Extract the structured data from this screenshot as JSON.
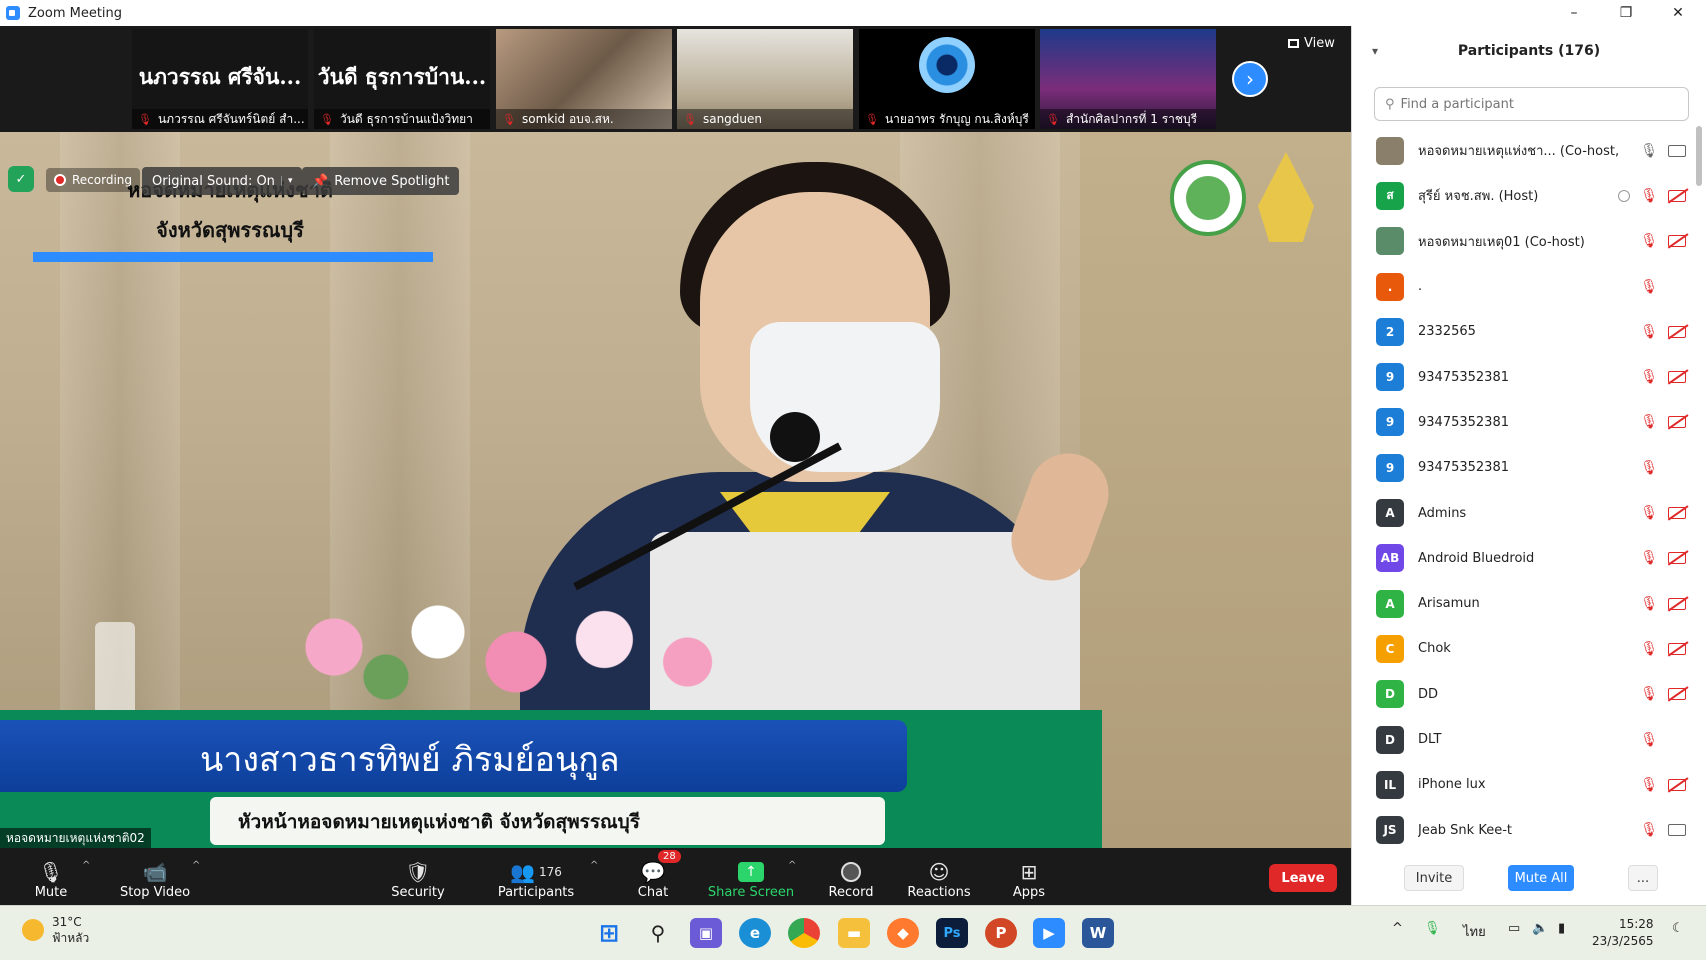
{
  "window": {
    "title": "Zoom Meeting",
    "controls": [
      "–",
      "❐",
      "✕"
    ]
  },
  "thumbnails": [
    {
      "big": "นภวรรณ ศรีจัน...",
      "name": "นภวรรณ ศรีจันทร์นิตย์ สำ..."
    },
    {
      "big": "วันดี ธุรการบ้าน...",
      "name": "วันดี ธุรการบ้านแป้งวิทยา"
    },
    {
      "big": "",
      "name": "somkid อบจ.สห."
    },
    {
      "big": "",
      "name": "sangduen"
    },
    {
      "big": "",
      "name": "นายอาทร รักบุญ กน.สิงห์บุรี"
    },
    {
      "big": "",
      "name": "สำนักศิลปากรที่ 1 ราชบุรี"
    }
  ],
  "view_label": "View",
  "overlay": {
    "recording": "Recording",
    "original_sound": "Original Sound: On",
    "remove_spotlight": "Remove Spotlight"
  },
  "speaker": {
    "org_line1": "หอจดหมายเหตุแห่งชาติ",
    "org_line2": "จังหวัดสุพรรณบุรี",
    "lower_name": "นางสาวธารทิพย์ ภิรมย์อนุกูล",
    "lower_role": "หัวหน้าหอจดหมายเหตุแห่งชาติ จังหวัดสุพรรณบุรี",
    "nametag": "หอจดหมายเหตุแห่งชาติ02"
  },
  "toolbar": {
    "mute": "Mute",
    "stop_video": "Stop Video",
    "security": "Security",
    "participants": "Participants",
    "participants_count": "176",
    "chat": "Chat",
    "chat_badge": "28",
    "share_screen": "Share Screen",
    "record": "Record",
    "reactions": "Reactions",
    "apps": "Apps",
    "leave": "Leave"
  },
  "panel": {
    "title": "Participants (176)",
    "search_placeholder": "Find a participant",
    "invite": "Invite",
    "mute_all": "Mute All",
    "more": "..."
  },
  "participants": [
    {
      "initials": "",
      "color": "#8a7f6a",
      "name": "หอจดหมายเหตุแห่งชา... (Co-host, me)",
      "mic": "on",
      "cam": "on",
      "rec": false
    },
    {
      "initials": "ส",
      "color": "#16a34a",
      "name": "สุรีย์ หจช.สพ. (Host)",
      "mic": "muted",
      "cam": "off",
      "rec": true
    },
    {
      "initials": "",
      "color": "#5b8c6a",
      "name": "หอจดหมายเหตุ01 (Co-host)",
      "mic": "muted",
      "cam": "off",
      "rec": false
    },
    {
      "initials": ".",
      "color": "#e8590c",
      "name": ".",
      "mic": "muted",
      "cam": "none",
      "rec": false
    },
    {
      "initials": "2",
      "color": "#1c7ed6",
      "name": "2332565",
      "mic": "muted",
      "cam": "off",
      "rec": false
    },
    {
      "initials": "9",
      "color": "#1c7ed6",
      "name": "93475352381",
      "mic": "muted",
      "cam": "off",
      "rec": false
    },
    {
      "initials": "9",
      "color": "#1c7ed6",
      "name": "93475352381",
      "mic": "muted",
      "cam": "off",
      "rec": false
    },
    {
      "initials": "9",
      "color": "#1c7ed6",
      "name": "93475352381",
      "mic": "muted",
      "cam": "none",
      "rec": false
    },
    {
      "initials": "A",
      "color": "#343a40",
      "name": "Admins",
      "mic": "muted",
      "cam": "off",
      "rec": false
    },
    {
      "initials": "AB",
      "color": "#7048e8",
      "name": "Android Bluedroid",
      "mic": "muted",
      "cam": "off",
      "rec": false
    },
    {
      "initials": "A",
      "color": "#2fb344",
      "name": "Arisamun",
      "mic": "muted",
      "cam": "off",
      "rec": false
    },
    {
      "initials": "C",
      "color": "#f59f00",
      "name": "Chok",
      "mic": "muted",
      "cam": "off",
      "rec": false
    },
    {
      "initials": "D",
      "color": "#2fb344",
      "name": "DD",
      "mic": "muted",
      "cam": "off",
      "rec": false
    },
    {
      "initials": "D",
      "color": "#343a40",
      "name": "DLT",
      "mic": "muted",
      "cam": "none",
      "rec": false
    },
    {
      "initials": "IL",
      "color": "#343a40",
      "name": "iPhone lux",
      "mic": "muted",
      "cam": "off",
      "rec": false
    },
    {
      "initials": "JS",
      "color": "#343a40",
      "name": "Jeab Snk Kee-t",
      "mic": "muted",
      "cam": "on",
      "rec": false
    }
  ],
  "taskbar": {
    "temp": "31°C",
    "weather": "ฟ้าหลัว",
    "lang": "ไทย",
    "time": "15:28",
    "date": "23/3/2565"
  }
}
